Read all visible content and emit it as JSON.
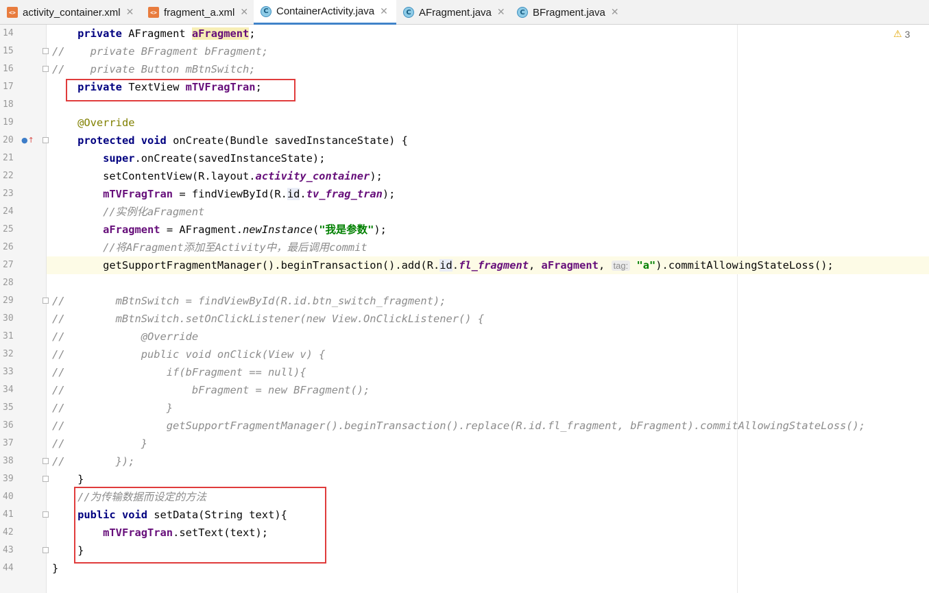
{
  "tabs": [
    {
      "label": "activity_container.xml",
      "kind": "xml",
      "active": false
    },
    {
      "label": "fragment_a.xml",
      "kind": "xml",
      "active": false
    },
    {
      "label": "ContainerActivity.java",
      "kind": "java",
      "active": true
    },
    {
      "label": "AFragment.java",
      "kind": "java",
      "active": false
    },
    {
      "label": "BFragment.java",
      "kind": "java",
      "active": false
    }
  ],
  "inspections": {
    "warning_count": "3"
  },
  "colors": {
    "keyword": "#000080",
    "field": "#660e7a",
    "comment": "#8c8c8c",
    "annotation": "#808000",
    "string": "#008000",
    "highlight_box": "#e03b3b",
    "active_tab_underline": "#4083c9"
  },
  "editor": {
    "current_line": 27,
    "lines": [
      {
        "n": 14,
        "segs": [
          [
            "",
            "    "
          ],
          [
            "kw",
            "private"
          ],
          [
            "",
            " AFragment "
          ],
          [
            "fld hl",
            "aFragment"
          ],
          [
            "",
            ";"
          ]
        ]
      },
      {
        "n": 15,
        "segs": [
          [
            "cm",
            "//    private BFragment bFragment;"
          ]
        ]
      },
      {
        "n": 16,
        "segs": [
          [
            "cm",
            "//    private Button mBtnSwitch;"
          ]
        ]
      },
      {
        "n": 17,
        "segs": [
          [
            "",
            "    "
          ],
          [
            "kw",
            "private"
          ],
          [
            "",
            " TextView "
          ],
          [
            "fld",
            "mTVFragTran"
          ],
          [
            "",
            ";"
          ]
        ]
      },
      {
        "n": 18,
        "segs": []
      },
      {
        "n": 19,
        "segs": [
          [
            "",
            "    "
          ],
          [
            "an",
            "@Override"
          ]
        ]
      },
      {
        "n": 20,
        "segs": [
          [
            "",
            "    "
          ],
          [
            "kw",
            "protected void"
          ],
          [
            "",
            " onCreate(Bundle savedInstanceState) {"
          ]
        ]
      },
      {
        "n": 21,
        "segs": [
          [
            "",
            "        "
          ],
          [
            "kw",
            "super"
          ],
          [
            "",
            ".onCreate(savedInstanceState);"
          ]
        ]
      },
      {
        "n": 22,
        "segs": [
          [
            "",
            "        setContentView(R.layout."
          ],
          [
            "fi",
            "activity_container"
          ],
          [
            "",
            ");"
          ]
        ]
      },
      {
        "n": 23,
        "segs": [
          [
            "",
            "        "
          ],
          [
            "fld",
            "mTVFragTran"
          ],
          [
            "",
            " = findViewById(R."
          ],
          [
            "hlid",
            "id"
          ],
          [
            "",
            "."
          ],
          [
            "fi",
            "tv_frag_tran"
          ],
          [
            "",
            ");"
          ]
        ]
      },
      {
        "n": 24,
        "segs": [
          [
            "",
            "        "
          ],
          [
            "cm",
            "//实例化aFragment"
          ]
        ]
      },
      {
        "n": 25,
        "segs": [
          [
            "",
            "        "
          ],
          [
            "fld",
            "aFragment"
          ],
          [
            "",
            " = AFragment."
          ],
          [
            "it",
            "newInstance"
          ],
          [
            "",
            "("
          ],
          [
            "st",
            "\"我是参数\""
          ],
          [
            "",
            ");"
          ]
        ]
      },
      {
        "n": 26,
        "segs": [
          [
            "",
            "        "
          ],
          [
            "cm",
            "//将AFragment添加至Activity中，最后调用commit"
          ]
        ]
      },
      {
        "n": 27,
        "segs": [
          [
            "",
            "        getSupportFragmentManager().beginTransaction().add(R."
          ],
          [
            "hlid",
            "id"
          ],
          [
            "",
            "."
          ],
          [
            "fi",
            "fl_fragment"
          ],
          [
            "",
            ", "
          ],
          [
            "fld",
            "aFragment"
          ],
          [
            "",
            ", "
          ],
          [
            "hint",
            "tag:"
          ],
          [
            "",
            " "
          ],
          [
            "st",
            "\"a\""
          ],
          [
            "",
            ").commitAllowingStateLoss();"
          ]
        ]
      },
      {
        "n": 28,
        "segs": []
      },
      {
        "n": 29,
        "segs": [
          [
            "cm",
            "//        mBtnSwitch = findViewById(R.id.btn_switch_fragment);"
          ]
        ]
      },
      {
        "n": 30,
        "segs": [
          [
            "cm",
            "//        mBtnSwitch.setOnClickListener(new View.OnClickListener() {"
          ]
        ]
      },
      {
        "n": 31,
        "segs": [
          [
            "cm",
            "//            @Override"
          ]
        ]
      },
      {
        "n": 32,
        "segs": [
          [
            "cm",
            "//            public void onClick(View v) {"
          ]
        ]
      },
      {
        "n": 33,
        "segs": [
          [
            "cm",
            "//                if(bFragment == null){"
          ]
        ]
      },
      {
        "n": 34,
        "segs": [
          [
            "cm",
            "//                    bFragment = new BFragment();"
          ]
        ]
      },
      {
        "n": 35,
        "segs": [
          [
            "cm",
            "//                }"
          ]
        ]
      },
      {
        "n": 36,
        "segs": [
          [
            "cm",
            "//                getSupportFragmentManager().beginTransaction().replace(R.id.fl_fragment, bFragment).commitAllowingStateLoss();"
          ]
        ]
      },
      {
        "n": 37,
        "segs": [
          [
            "cm",
            "//            }"
          ]
        ]
      },
      {
        "n": 38,
        "segs": [
          [
            "cm",
            "//        });"
          ]
        ]
      },
      {
        "n": 39,
        "segs": [
          [
            "",
            "    }"
          ]
        ]
      },
      {
        "n": 40,
        "segs": [
          [
            "",
            "    "
          ],
          [
            "cm",
            "//为传输数据而设定的方法"
          ]
        ]
      },
      {
        "n": 41,
        "segs": [
          [
            "",
            "    "
          ],
          [
            "kw",
            "public void"
          ],
          [
            "",
            " setData(String text){"
          ]
        ]
      },
      {
        "n": 42,
        "segs": [
          [
            "",
            "        "
          ],
          [
            "fld",
            "mTVFragTran"
          ],
          [
            "",
            ".setText(text);"
          ]
        ]
      },
      {
        "n": 43,
        "segs": [
          [
            "",
            "    }"
          ]
        ]
      },
      {
        "n": 44,
        "segs": [
          [
            "",
            "}"
          ]
        ]
      }
    ]
  }
}
